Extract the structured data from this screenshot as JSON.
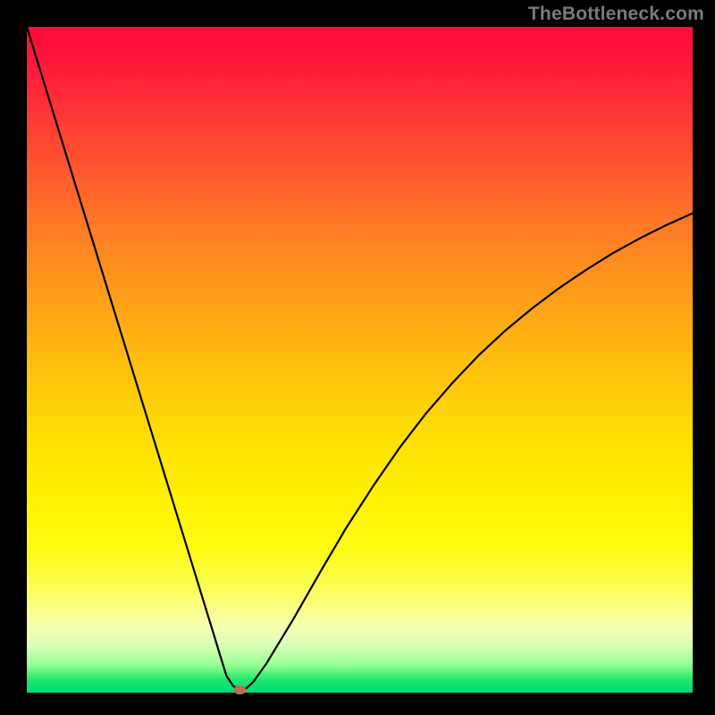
{
  "attribution": "TheBottleneck.com",
  "chart_data": {
    "type": "line",
    "title": "",
    "xlabel": "",
    "ylabel": "",
    "xlim": [
      0,
      100
    ],
    "ylim": [
      0,
      100
    ],
    "grid": false,
    "legend": false,
    "series": [
      {
        "name": "bottleneck-curve",
        "x": [
          0,
          2,
          4,
          6,
          8,
          10,
          12,
          14,
          16,
          18,
          20,
          22,
          24,
          26,
          28,
          29,
          30,
          31,
          32,
          33,
          34,
          36,
          40,
          44,
          48,
          52,
          56,
          60,
          64,
          68,
          72,
          76,
          80,
          84,
          88,
          92,
          96,
          100
        ],
        "y": [
          100,
          93.5,
          87,
          80.5,
          74,
          67.5,
          61,
          54.5,
          48,
          41.5,
          35,
          28.5,
          22,
          15.5,
          9,
          5.7,
          2.5,
          1,
          0.4,
          0.7,
          1.6,
          4.4,
          11,
          18,
          24.8,
          31,
          36.8,
          42,
          46.6,
          50.8,
          54.5,
          57.8,
          60.8,
          63.5,
          66,
          68.2,
          70.2,
          72
        ]
      }
    ],
    "markers": [
      {
        "name": "optimal-point",
        "x": 32,
        "y": 0.4,
        "color": "#c46a5c"
      }
    ],
    "gradient_stops": [
      {
        "pos": 0,
        "color": "#ff0a3a"
      },
      {
        "pos": 50,
        "color": "#ffc000"
      },
      {
        "pos": 80,
        "color": "#fff000"
      },
      {
        "pos": 100,
        "color": "#00d87a"
      }
    ]
  }
}
